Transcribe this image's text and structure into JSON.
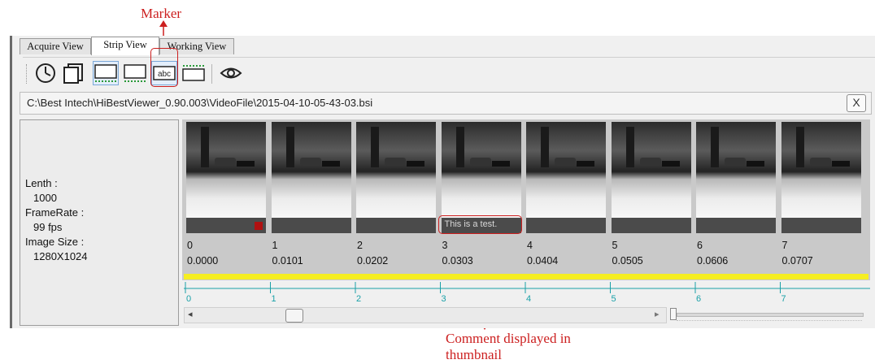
{
  "annotations": {
    "marker": "Marker",
    "comment_line1": "Comment displayed in",
    "comment_line2": "thumbnail",
    "color": "#cc1f1f"
  },
  "tabs": [
    {
      "label": "Acquire View",
      "active": false
    },
    {
      "label": "Strip View",
      "active": true
    },
    {
      "label": "Working View",
      "active": false
    }
  ],
  "toolbar": {
    "buttons": [
      "clock-icon",
      "copy-frames-icon",
      "thumbnail-strip-icon",
      "thumbnail-strip-alt-icon",
      "marker-abc-icon",
      "timeline-ruler-icon",
      "eye-icon"
    ],
    "marker_text": "abc"
  },
  "path": {
    "text": "C:\\Best Intech\\HiBestViewer_0.90.003\\VideoFile\\2015-04-10-05-43-03.bsi",
    "close": "X"
  },
  "info": {
    "length_label": "Lenth :",
    "length_value": "1000",
    "framerate_label": "FrameRate :",
    "framerate_value": "99 fps",
    "size_label": "Image Size :",
    "size_value": "1280X1024"
  },
  "frames": [
    {
      "index": "0",
      "time": "0.0000",
      "comment": ""
    },
    {
      "index": "1",
      "time": "0.0101",
      "comment": ""
    },
    {
      "index": "2",
      "time": "0.0202",
      "comment": ""
    },
    {
      "index": "3",
      "time": "0.0303",
      "comment": "This is a test."
    },
    {
      "index": "4",
      "time": "0.0404",
      "comment": ""
    },
    {
      "index": "5",
      "time": "0.0505",
      "comment": ""
    },
    {
      "index": "6",
      "time": "0.0606",
      "comment": ""
    },
    {
      "index": "7",
      "time": "0.0707",
      "comment": ""
    }
  ],
  "ruler": [
    "0",
    "1",
    "2",
    "3",
    "4",
    "5",
    "6",
    "7"
  ],
  "scroll": {
    "left_arrow": "◂",
    "right_arrow": "▸"
  },
  "colors": {
    "highlight": "#f5ee22",
    "ruler": "#1aa0a7",
    "marker": "#b01010"
  }
}
